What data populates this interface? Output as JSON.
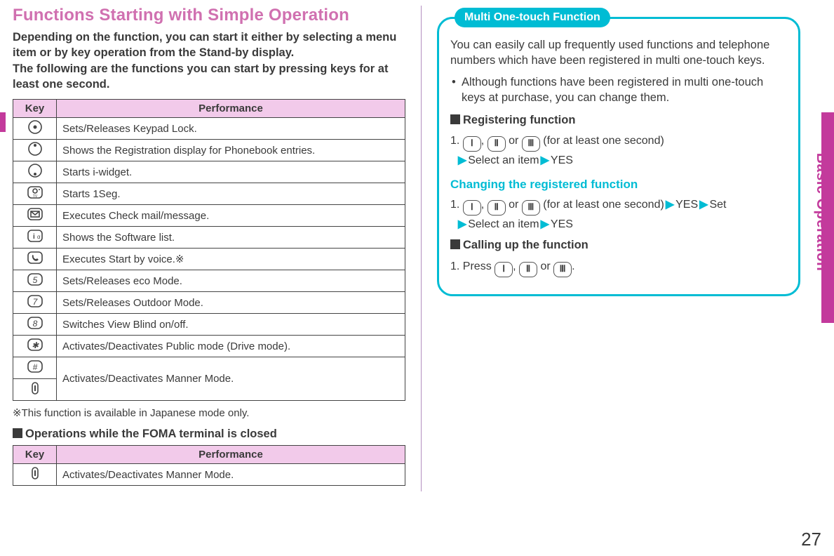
{
  "page_number": "27",
  "side_tab": "Basic Operation",
  "left": {
    "title": "Functions Starting with Simple Operation",
    "intro": "Depending on the function, you can start it either by selecting a menu item or by key operation from the Stand-by display.\nThe following are the functions you can start by pressing keys for at least one second.",
    "table1": {
      "head_key": "Key",
      "head_perf": "Performance",
      "rows": [
        {
          "icon": "dot-center",
          "perf": "Sets/Releases Keypad Lock."
        },
        {
          "icon": "dot-top",
          "perf": "Shows the Registration display for Phonebook entries."
        },
        {
          "icon": "dot-bottom",
          "perf": "Starts i-widget."
        },
        {
          "icon": "camera",
          "perf": "Starts 1Seg."
        },
        {
          "icon": "mail",
          "perf": "Executes Check mail/message."
        },
        {
          "icon": "i-alpha",
          "perf": "Shows the Software list."
        },
        {
          "icon": "phone",
          "perf": "Executes Start by voice.※"
        },
        {
          "icon": "five",
          "perf": "Sets/Releases eco Mode."
        },
        {
          "icon": "seven",
          "perf": "Sets/Releases Outdoor Mode."
        },
        {
          "icon": "eight",
          "perf": "Switches View Blind on/off."
        },
        {
          "icon": "star",
          "perf": "Activates/Deactivates Public mode (Drive mode)."
        },
        {
          "icon": "hash",
          "perf": "Activates/Deactivates Manner Mode."
        },
        {
          "icon": "side",
          "perf": ""
        }
      ]
    },
    "footnote": "※This function is available in Japanese mode only.",
    "closed_heading": "Operations while the FOMA terminal is closed",
    "table2": {
      "head_key": "Key",
      "head_perf": "Performance",
      "rows": [
        {
          "icon": "side",
          "perf": "Activates/Deactivates Manner Mode."
        }
      ]
    }
  },
  "right": {
    "box_label": "Multi One-touch Function",
    "intro": "You can easily call up frequently used functions and telephone numbers which have been registered in multi one-touch keys.",
    "bullet": "Although functions have been registered in multi one-touch keys at purchase, you can change them.",
    "reg_heading": "Registering function",
    "reg_step_prefix": "1.",
    "reg_step_keys": [
      "Ⅰ",
      "Ⅱ",
      "Ⅲ"
    ],
    "reg_step_suffix": "(for at least one second)",
    "reg_step_line2a": "Select an item",
    "reg_step_line2b": "YES",
    "change_heading": "Changing the registered function",
    "change_step_prefix": "1.",
    "change_step_suffix": "(for at least one second)",
    "change_step_tail1": "YES",
    "change_step_tail2": "Set",
    "change_step_line2a": "Select an item",
    "change_step_line2b": "YES",
    "call_heading": "Calling up the function",
    "call_step_prefix": "1. Press",
    "call_step_suffix": "."
  }
}
